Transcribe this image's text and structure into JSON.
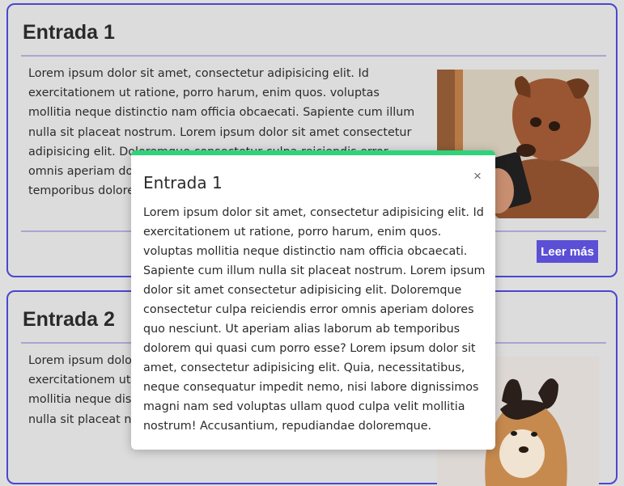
{
  "entries": [
    {
      "title": "Entrada 1",
      "text": "Lorem ipsum dolor sit amet, consectetur adipisicing elit. Id exercitationem ut ratione, porro harum, enim quos. voluptas mollitia neque distinctio nam officia obcaecati. Sapiente cum illum nulla sit placeat nostrum. Lorem ipsum dolor sit amet consectetur adipisicing elit. Doloremque consectetur culpa reiciendis error omnis aperiam dolores quo nesciunt. Ut aperiam alias laborum ab temporibus dolorem qui quasi cum porro esse?",
      "button_label": "Leer más",
      "image": "dog-holding-phone-photo"
    },
    {
      "title": "Entrada 2",
      "text": "Lorem ipsum dolor sit amet, consectetur adipisicing elit. Id exercitationem ut ratione, porro harum, enim quos. voluptas mollitia neque distinctio nam officia obcaecati. Sapiente cum illum nulla sit placeat nostrum.",
      "image": "shiba-dog-photo"
    }
  ],
  "modal": {
    "title": "Entrada 1",
    "close_label": "×",
    "body": "Lorem ipsum dolor sit amet, consectetur adipisicing elit. Id exercitationem ut ratione, porro harum, enim quos. voluptas mollitia neque distinctio nam officia obcaecati. Sapiente cum illum nulla sit placeat nostrum. Lorem ipsum dolor sit amet consectetur adipisicing elit. Doloremque consectetur culpa reiciendis error omnis aperiam dolores quo nesciunt. Ut aperiam alias laborum ab temporibus dolorem qui quasi cum porro esse? Lorem ipsum dolor sit amet, consectetur adipisicing elit. Quia, necessitatibus, neque consequatur impedit nemo, nisi labore dignissimos magni nam sed voluptas ullam quod culpa velit mollitia nostrum! Accusantium, repudiandae doloremque."
  },
  "colors": {
    "card_border": "#4a46d0",
    "button_bg": "#5b4fd6",
    "modal_accent": "#2ed37a",
    "backdrop": "#dedede"
  }
}
